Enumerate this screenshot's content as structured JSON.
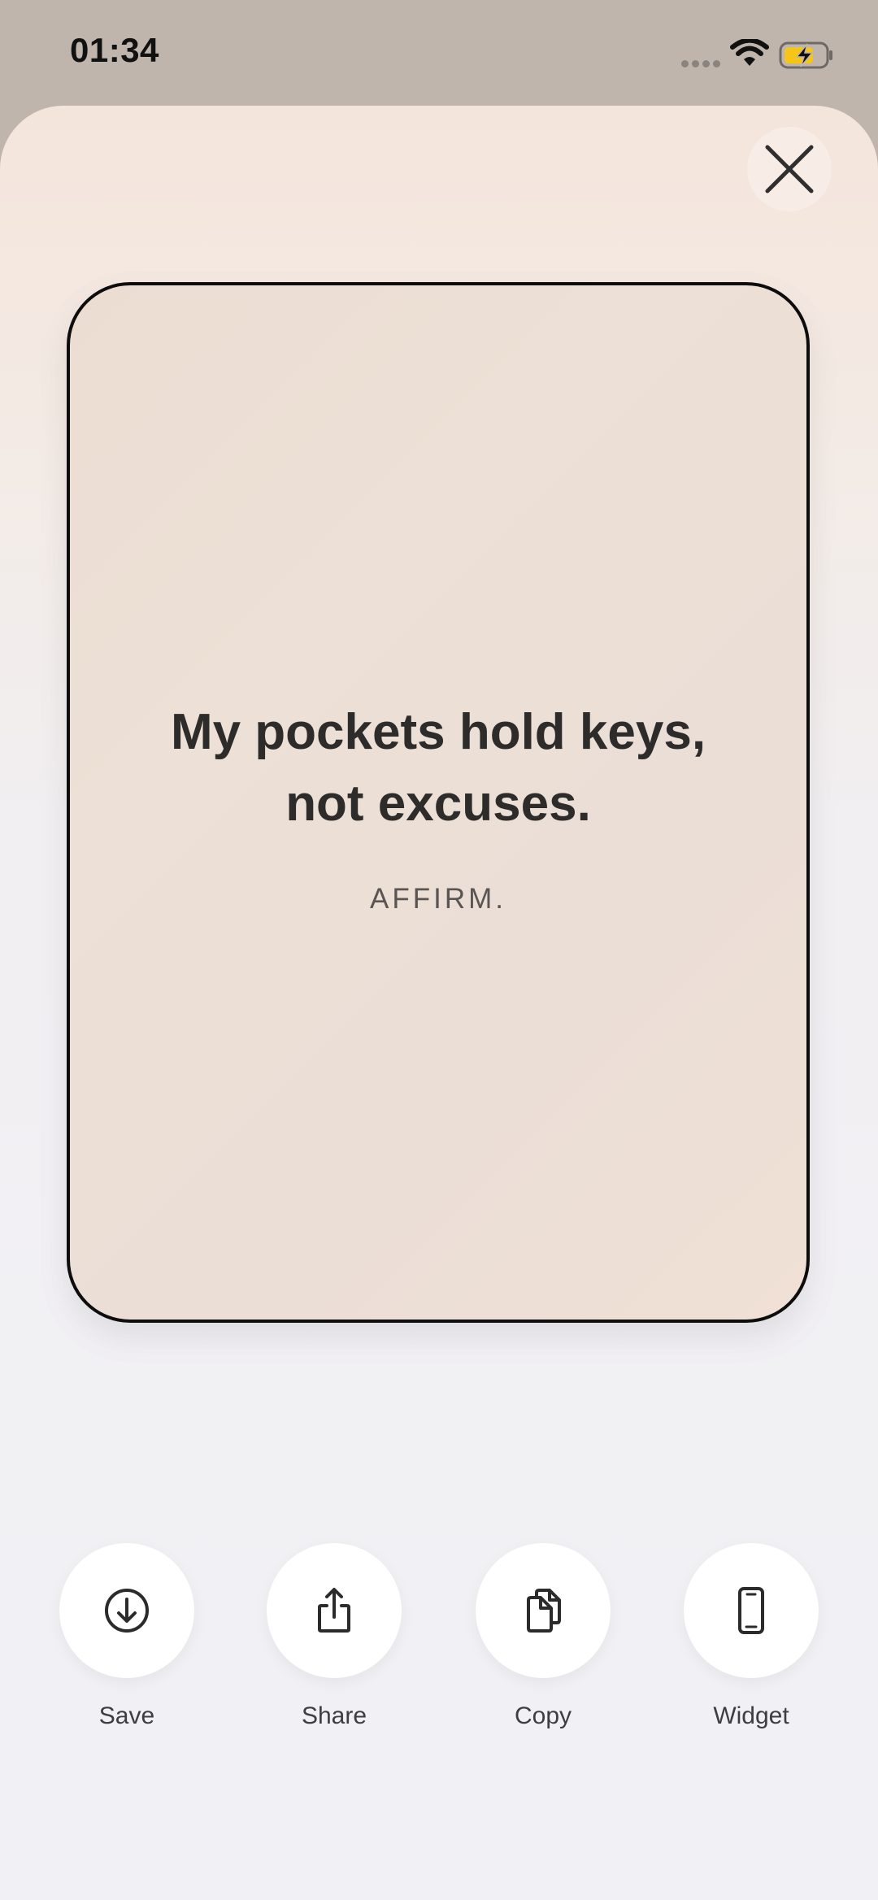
{
  "status_bar": {
    "time": "01:34",
    "icons": [
      "signal-icon",
      "wifi-icon",
      "battery-charging-icon"
    ],
    "battery_color": "#f5c518"
  },
  "card": {
    "quote_line1": "My pockets hold keys,",
    "quote_line2": "not excuses.",
    "brand": "AFFIRM."
  },
  "actions": [
    {
      "label": "Save",
      "icon": "download-icon"
    },
    {
      "label": "Share",
      "icon": "share-icon"
    },
    {
      "label": "Copy",
      "icon": "copy-icon"
    },
    {
      "label": "Widget",
      "icon": "phone-widget-icon"
    }
  ],
  "close_icon": "close-icon"
}
